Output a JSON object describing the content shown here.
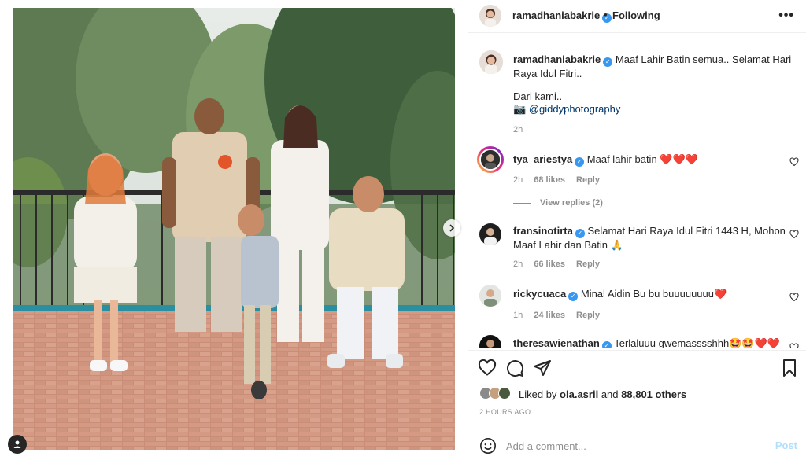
{
  "post": {
    "author": "ramadhaniabakrie",
    "follow_status": "Following",
    "separator": "•",
    "more_glyph": "•••"
  },
  "caption": {
    "username": "ramadhaniabakrie",
    "line1": "Maaf Lahir Batin semua.. Selamat Hari Raya Idul Fitri..",
    "line2": "Dari kami..",
    "camera_emoji": "📷",
    "photographer": "@giddyphotography",
    "time": "2h"
  },
  "comments": [
    {
      "username": "tya_ariestya",
      "text": "Maaf lahir batin ❤️❤️❤️",
      "time": "2h",
      "likes": "68 likes",
      "reply": "Reply",
      "view_replies": "View replies (2)"
    },
    {
      "username": "fransinotirta",
      "text": "Selamat Hari Raya Idul Fitri 1443 H, Mohon Maaf Lahir dan Batin 🙏",
      "time": "2h",
      "likes": "66 likes",
      "reply": "Reply"
    },
    {
      "username": "rickycuaca",
      "text": "Minal Aidin Bu bu buuuuuuuu❤️",
      "time": "1h",
      "likes": "24 likes",
      "reply": "Reply"
    },
    {
      "username": "theresawienathan",
      "text": "Terlaluuu gwemasssshhh🤩🤩❤️❤️"
    }
  ],
  "likes": {
    "prefix": "Liked by",
    "liker": "ola.asril",
    "joiner": "and",
    "others": "88,801 others"
  },
  "timestamp": "2 HOURS AGO",
  "composer": {
    "placeholder": "Add a comment...",
    "post_label": "Post"
  },
  "icons": [
    "heart-icon",
    "comment-icon",
    "share-icon",
    "bookmark-icon",
    "emoji-icon",
    "more-icon",
    "verified-icon",
    "chevron-right-icon",
    "user-tag-icon"
  ],
  "colors": {
    "accent": "#3897f0",
    "link": "#00376b",
    "muted": "#8e8e8e",
    "post_disabled": "#b2dffc",
    "heart": "#ed1c24"
  }
}
